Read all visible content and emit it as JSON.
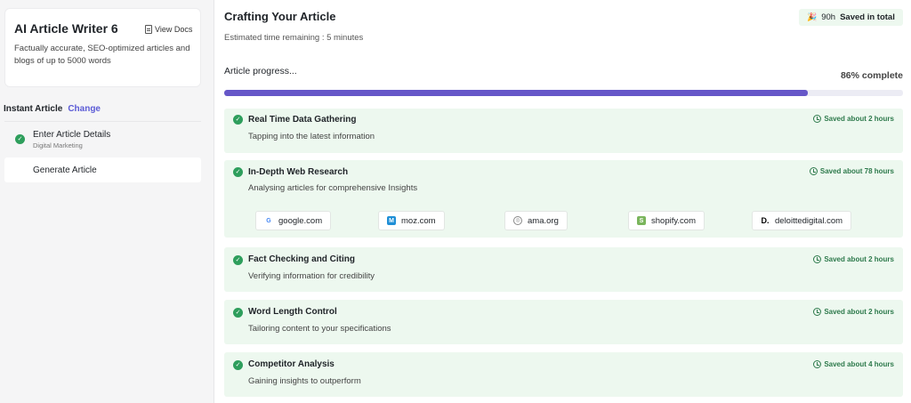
{
  "sidebar": {
    "app_title": "AI Article Writer 6",
    "docs_label": "View Docs",
    "description": "Factually accurate, SEO-optimized articles and blogs of up to 5000 words",
    "mode_label": "Instant Article",
    "change_label": "Change",
    "steps": [
      {
        "title": "Enter Article Details",
        "subtitle": "Digital Marketing",
        "done": true
      },
      {
        "title": "Generate Article"
      }
    ]
  },
  "header": {
    "title": "Crafting Your Article",
    "eta": "Estimated time remaining : 5 minutes",
    "saved_hours": "90h",
    "saved_text": "Saved in total"
  },
  "progress": {
    "label": "Article progress...",
    "percent_text": "86% complete",
    "value": 0.86
  },
  "tasks": [
    {
      "title": "Real Time Data Gathering",
      "desc": "Tapping into the latest information",
      "saved": "Saved about 2 hours"
    },
    {
      "title": "In-Depth Web Research",
      "desc": "Analysing articles for comprehensive Insights",
      "saved": "Saved about 78 hours",
      "sources": [
        "google.com",
        "moz.com",
        "ama.org",
        "shopify.com",
        "deloittedigital.com"
      ]
    },
    {
      "title": "Fact Checking and Citing",
      "desc": "Verifying information for credibility",
      "saved": "Saved about 2 hours"
    },
    {
      "title": "Word Length Control",
      "desc": "Tailoring content to your specifications",
      "saved": "Saved about 2 hours"
    },
    {
      "title": "Competitor Analysis",
      "desc": "Gaining insights to outperform",
      "saved": "Saved about 4 hours"
    }
  ],
  "colors": {
    "accent": "#6657c8",
    "success": "#2e9e5c",
    "task_bg": "#edf8ef"
  }
}
